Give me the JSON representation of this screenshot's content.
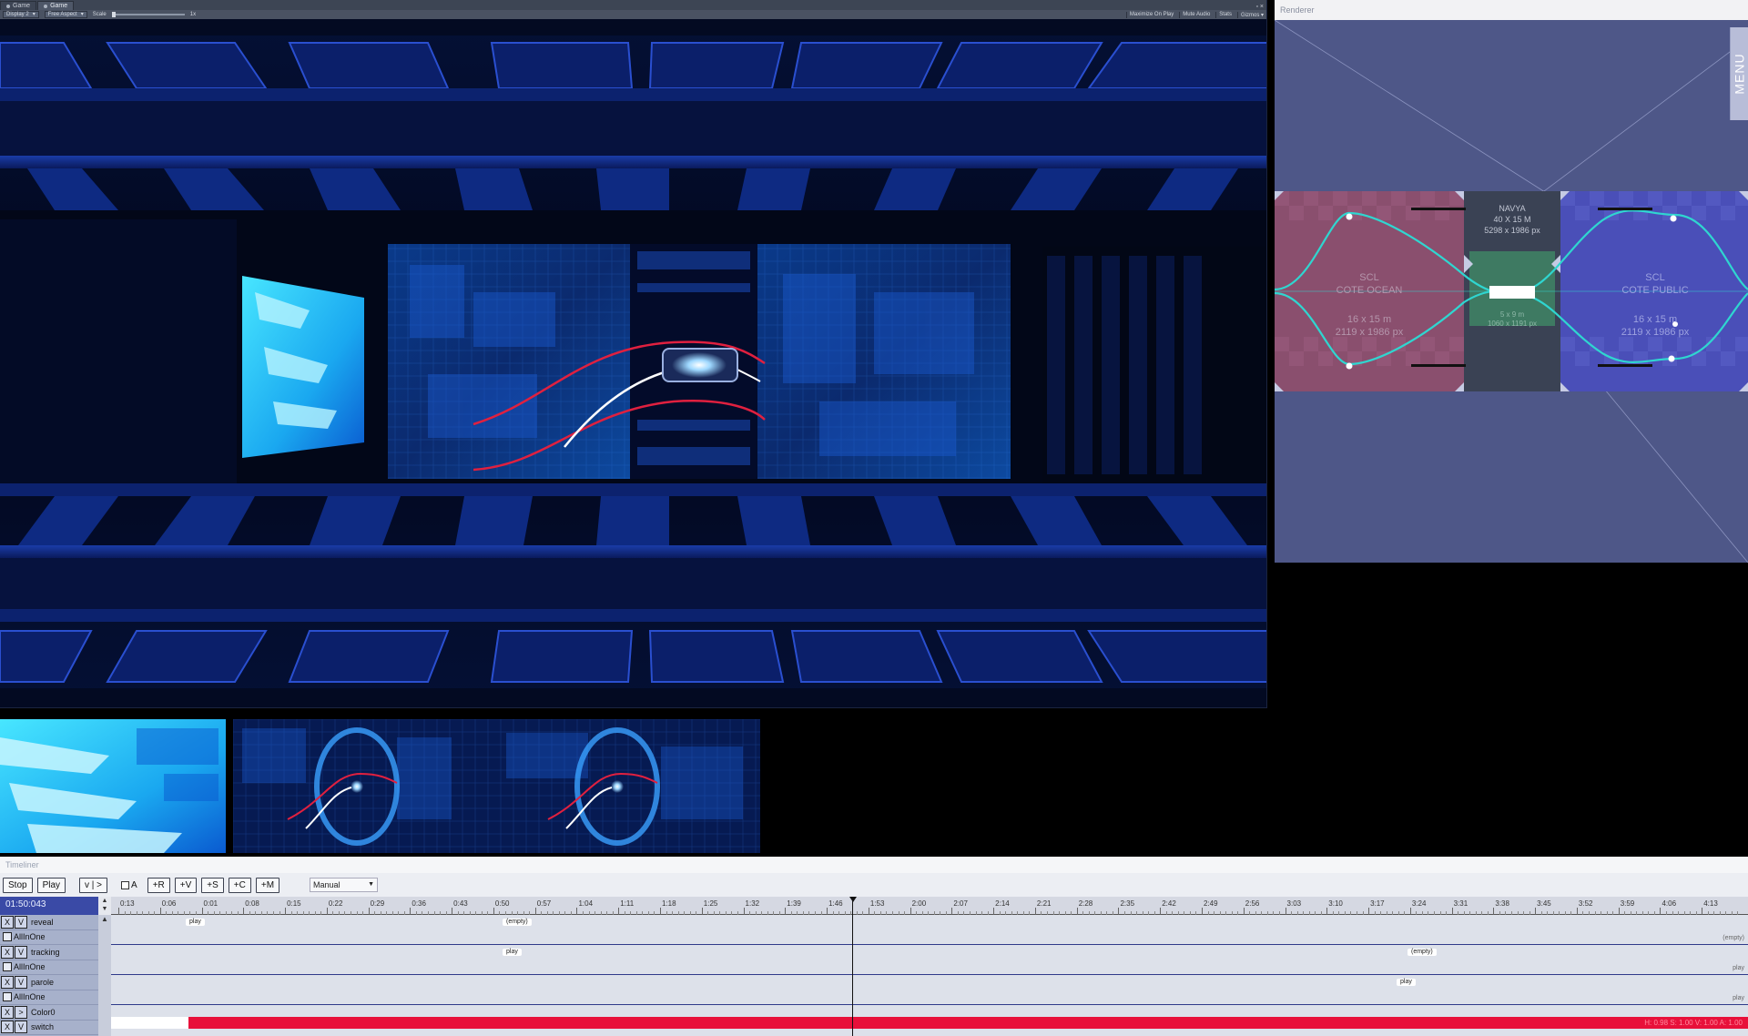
{
  "game_window": {
    "tabs": [
      {
        "label": "Game"
      },
      {
        "label": "Game"
      }
    ],
    "window_controls": "▫ ×",
    "toolbar": {
      "display": "Display 2",
      "aspect": "Free Aspect",
      "scale_label": "Scale",
      "scale_value": "1x",
      "buttons": [
        "Maximize On Play",
        "Mute Audio",
        "Stats",
        "Gizmos ▾"
      ]
    }
  },
  "renderer": {
    "title": "Renderer",
    "menu_label": "MENU",
    "zones": {
      "left": {
        "name": "SCL",
        "sub": "COTE OCEAN",
        "size_m": "16 x 15 m",
        "size_px": "2119 x 1986 px"
      },
      "center": {
        "name": "NAVYA",
        "size_m": "40 X 15 M",
        "size_px": "5298 x 1986 px",
        "inner_size_m": "5 x 9 m",
        "inner_size_px": "1060 x 1191 px"
      },
      "right": {
        "name": "SCL",
        "sub": "COTE PUBLIC",
        "size_m": "16 x 15 m",
        "size_px": "2119 x 1986 px"
      }
    },
    "colors": {
      "bg": "#4e5788",
      "left_zone": "#8a4f6e",
      "center_zone": "#3a4254",
      "right_zone": "#4a4fb8",
      "curve": "#2fd6d0"
    }
  },
  "timeliner": {
    "title": "Timeliner",
    "buttons": {
      "stop": "Stop",
      "play": "Play",
      "vi": "v | >",
      "auto": "A",
      "add_r": "+R",
      "add_v": "+V",
      "add_s": "+S",
      "add_c": "+C",
      "add_m": "+M"
    },
    "mode": "Manual",
    "current_time": "01:50:043",
    "ruler_labels": [
      "0:13",
      "0:06",
      "0:01",
      "0:08",
      "0:15",
      "0:22",
      "0:29",
      "0:36",
      "0:43",
      "0:50",
      "0:57",
      "1:04",
      "1:11",
      "1:18",
      "1:25",
      "1:32",
      "1:39",
      "1:46",
      "1:53",
      "2:00",
      "2:07",
      "2:14",
      "2:21",
      "2:28",
      "2:35",
      "2:42",
      "2:49",
      "2:56",
      "3:03",
      "3:10",
      "3:17",
      "3:24",
      "3:31",
      "3:38",
      "3:45",
      "3:52",
      "3:59",
      "4:06",
      "4:13"
    ],
    "track_rows": [
      {
        "x": "X",
        "v": "V",
        "label": "reveal"
      },
      {
        "label": "AllInOne"
      },
      {
        "x": "X",
        "v": "V",
        "label": "tracking"
      },
      {
        "label": "AllInOne"
      },
      {
        "x": "X",
        "v": "V",
        "label": "parole"
      },
      {
        "label": "AllInOne"
      },
      {
        "x": "X",
        "v": ">",
        "label": "Color0"
      },
      {
        "x": "X",
        "v": "V",
        "label": "switch"
      }
    ],
    "clips": {
      "reveal_play": "play",
      "reveal_empty": "(empty)",
      "reveal_end": "(empty)",
      "tracking_play": "play",
      "tracking_empty": "(empty)",
      "tracking_end": "play",
      "parole_play": "play",
      "parole_end": "play"
    },
    "color_readout": "H: 0.98 S: 1.00 V: 1.00 A: 1.00",
    "colors": {
      "time_bg": "#3a4aa6",
      "color_track": "#e8103a"
    }
  }
}
